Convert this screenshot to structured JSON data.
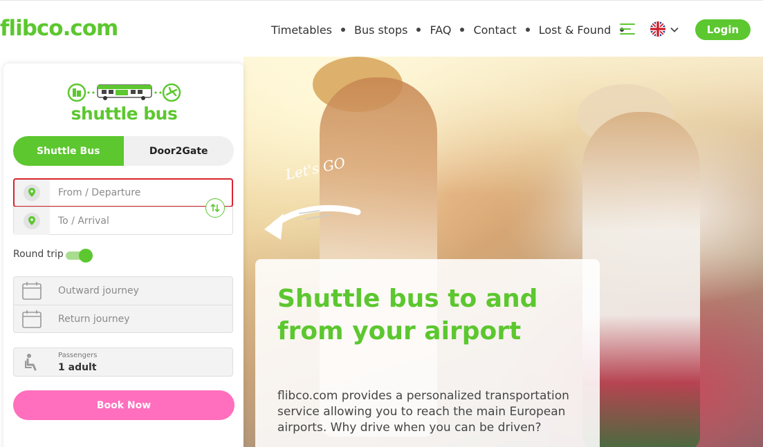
{
  "header": {
    "logo": "flibco.com",
    "nav": [
      "Timetables",
      "Bus stops",
      "FAQ",
      "Contact",
      "Lost & Found"
    ],
    "language_flag": "uk-flag-icon",
    "login_label": "Login"
  },
  "booking": {
    "brand_label": "shuttle bus",
    "tabs": [
      {
        "label": "Shuttle Bus",
        "active": true
      },
      {
        "label": "Door2Gate",
        "active": false
      }
    ],
    "from_placeholder": "From / Departure",
    "to_placeholder": "To / Arrival",
    "round_trip_label": "Round trip",
    "round_trip_on": true,
    "outward_placeholder": "Outward journey",
    "return_placeholder": "Return journey",
    "passengers_label": "Passengers",
    "passengers_value": "1 adult",
    "book_label": "Book Now"
  },
  "hero": {
    "handwritten": "Let's GO",
    "title": "Shuttle bus to and from your airport",
    "description": "flibco.com provides a personalized transportation service allowing you to reach the main European airports. Why drive when you can be driven?"
  },
  "colors": {
    "brand_green": "#5cc72f",
    "book_pink": "#ff6fbd",
    "highlight_red": "#d9232e"
  }
}
